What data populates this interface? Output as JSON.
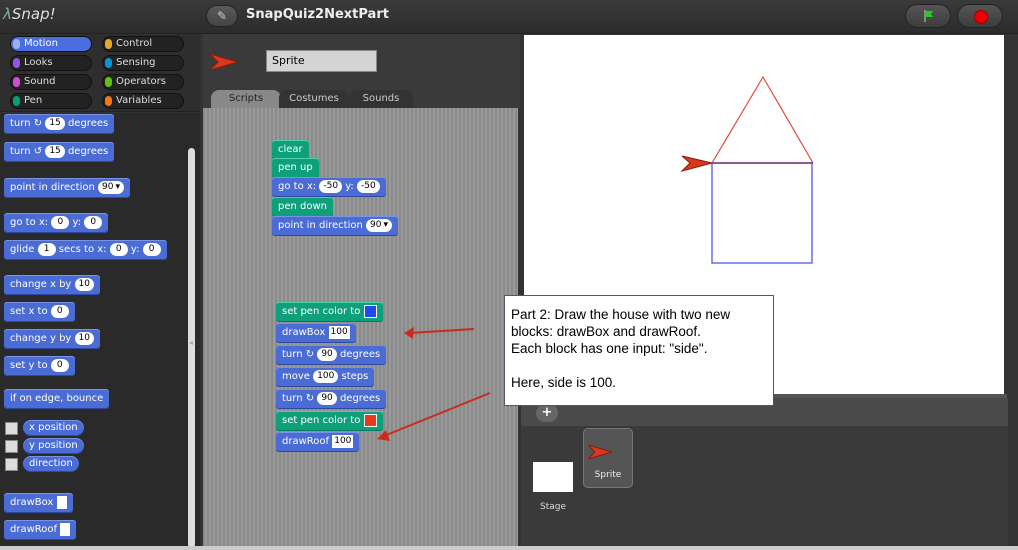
{
  "app": {
    "logo_text": "Snap!",
    "project_title": "SnapQuiz2NextPart"
  },
  "categories": [
    {
      "label": "Motion",
      "color": "#4a6cd4"
    },
    {
      "label": "Control",
      "color": "#e6a822"
    },
    {
      "label": "Looks",
      "color": "#8f56e3"
    },
    {
      "label": "Sensing",
      "color": "#0494dc"
    },
    {
      "label": "Sound",
      "color": "#cf4ad9"
    },
    {
      "label": "Operators",
      "color": "#62c213"
    },
    {
      "label": "Pen",
      "color": "#00a178"
    },
    {
      "label": "Variables",
      "color": "#f3761d"
    }
  ],
  "palette": {
    "turn_cw": {
      "label": "turn",
      "value": "15",
      "unit": "degrees"
    },
    "turn_ccw": {
      "label": "turn",
      "value": "15",
      "unit": "degrees"
    },
    "point_in_direction": {
      "label": "point in direction",
      "value": "90"
    },
    "go_to": {
      "label": "go to x:",
      "x": "0",
      "ylabel": "y:",
      "y": "0"
    },
    "glide": {
      "label": "glide",
      "secs": "1",
      "mid": "secs to x:",
      "x": "0",
      "ylabel": "y:",
      "y": "0"
    },
    "change_x": {
      "label": "change x by",
      "value": "10"
    },
    "set_x": {
      "label": "set x to",
      "value": "0"
    },
    "change_y": {
      "label": "change y by",
      "value": "10"
    },
    "set_y": {
      "label": "set y to",
      "value": "0"
    },
    "bounce": {
      "label": "if on edge, bounce"
    },
    "x_position": {
      "label": "x position"
    },
    "y_position": {
      "label": "y position"
    },
    "direction": {
      "label": "direction"
    },
    "draw_box": {
      "label": "drawBox"
    },
    "draw_roof": {
      "label": "drawRoof"
    }
  },
  "sprite": {
    "name": "Sprite"
  },
  "tabs": [
    "Scripts",
    "Costumes",
    "Sounds"
  ],
  "scripts": {
    "clear": "clear",
    "pen_up": "pen up",
    "go_to": {
      "label": "go to x:",
      "x": "-50",
      "ylabel": "y:",
      "y": "-50"
    },
    "pen_down": "pen down",
    "point_dir": {
      "label": "point in direction",
      "value": "90"
    },
    "set_pen_blue": {
      "label": "set pen color to",
      "color": "#1f4af0"
    },
    "draw_box": {
      "label": "drawBox",
      "value": "100"
    },
    "turn1": {
      "label": "turn",
      "value": "90",
      "unit": "degrees"
    },
    "move": {
      "label": "move",
      "value": "100",
      "unit": "steps"
    },
    "turn2": {
      "label": "turn",
      "value": "90",
      "unit": "degrees"
    },
    "set_pen_red": {
      "label": "set pen color to",
      "color": "#e83a1a"
    },
    "draw_roof": {
      "label": "drawRoof",
      "value": "100"
    }
  },
  "callout": {
    "line1": "Part 2: Draw the house with two new",
    "line2": "blocks: drawBox and drawRoof.",
    "line3": "Each block has one input: \"side\".",
    "line4": "Here, side is 100."
  },
  "corral": {
    "stage_label": "Stage",
    "sprite_label": "Sprite",
    "add_label": "+"
  },
  "colors": {
    "box": "#6b6be8",
    "roof": "#e04a3a",
    "arrow": "#cc2a1e",
    "sprite": "#d8381e"
  }
}
